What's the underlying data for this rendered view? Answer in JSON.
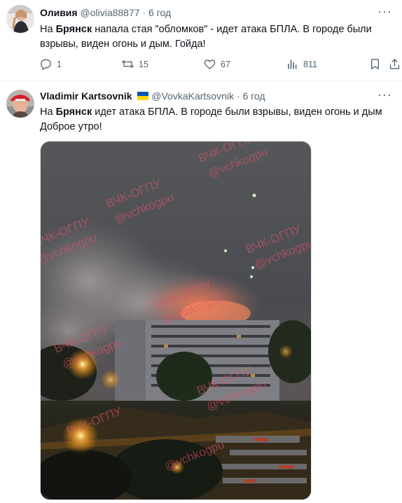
{
  "tweet1": {
    "display_name": "Оливия",
    "handle": "@olivia88877",
    "dot": "·",
    "time": "6 год",
    "text_prefix": "На ",
    "text_bold": "Брянск",
    "text_line1_rest": " напала стая \"обломков\" - идет атака БПЛА. В городе были",
    "text_line2": "взрывы, виден огонь и дым. Гойда!",
    "replies": "1",
    "retweets": "15",
    "likes": "67",
    "views": "811"
  },
  "tweet2": {
    "display_name": "Vladimir Kartsovnik",
    "handle": "@VovkaKartsovnik",
    "dot": "·",
    "time": "6 год",
    "text_prefix": "На ",
    "text_bold": "Брянск",
    "text_line1_rest": " идет атака БПЛА. В городе были взрывы, виден огонь и дым",
    "text_line2": "Доброе утро!"
  },
  "image_watermarks": [
    "ВЧК-ОГПУ",
    "@vchkogpu"
  ],
  "colors": {
    "text": "#0f1419",
    "muted": "#536471",
    "flag_blue": "#0057b7",
    "flag_yellow": "#ffd700"
  },
  "icons": [
    "reply-icon",
    "retweet-icon",
    "like-icon",
    "views-icon",
    "bookmark-icon",
    "more-icon"
  ]
}
